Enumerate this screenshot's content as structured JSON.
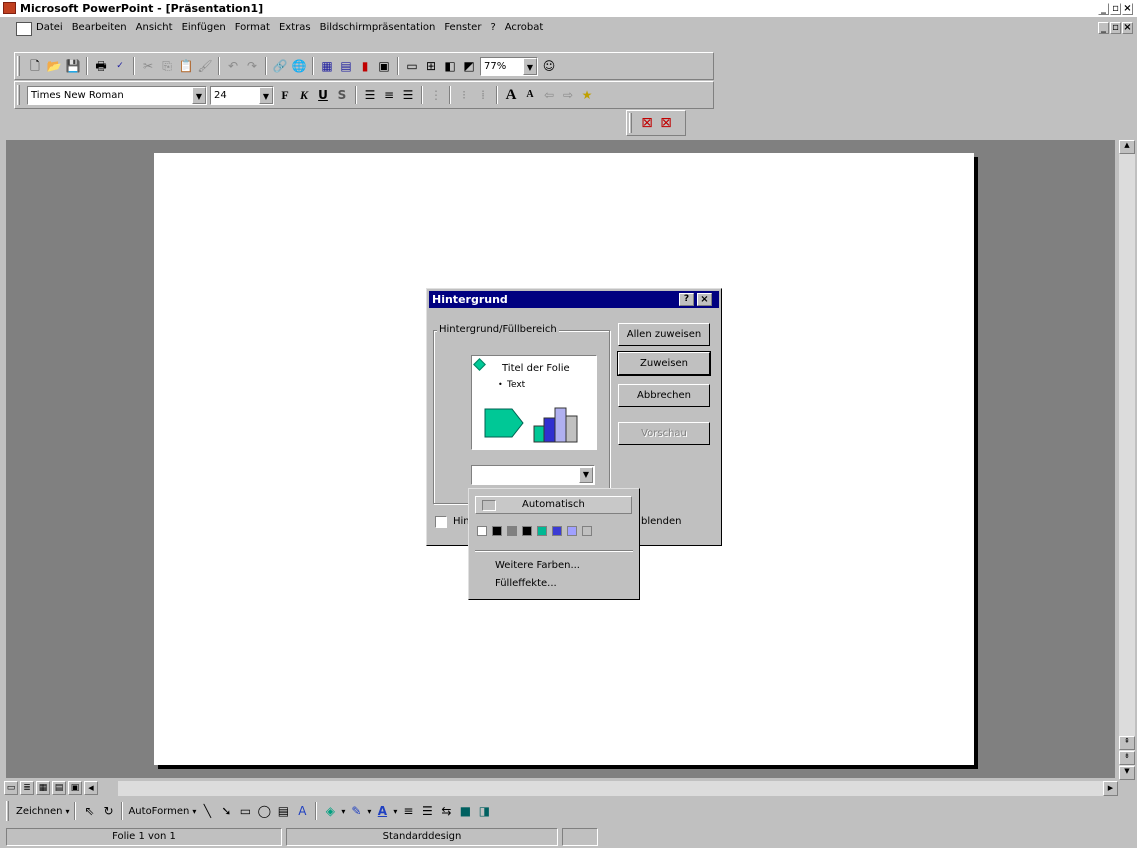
{
  "window": {
    "title": "Microsoft PowerPoint - [Präsentation1]",
    "controls": [
      "_",
      "▫",
      "×"
    ]
  },
  "menu": {
    "items": [
      "Datei",
      "Bearbeiten",
      "Ansicht",
      "Einfügen",
      "Format",
      "Extras",
      "Bildschirmpräsentation",
      "Fenster",
      "?",
      "Acrobat"
    ]
  },
  "standard_toolbar": {
    "zoom": "77%"
  },
  "format_toolbar": {
    "font": "Times New Roman",
    "size": "24",
    "bold_label": "F",
    "italic_label": "K",
    "underline_label": "U",
    "shadow_label": "S"
  },
  "dialog": {
    "title": "Hintergrund",
    "group_label": "Hintergrund/Füllbereich",
    "preview": {
      "slide_title": "Titel der Folie",
      "bullet_text": "Text"
    },
    "checkbox_label_visible": "Hin",
    "checkbox_label_tail": "blenden",
    "buttons": {
      "apply_all": "Allen zuweisen",
      "apply": "Zuweisen",
      "cancel": "Abbrechen",
      "preview": "Vorschau"
    },
    "help_btn": "?",
    "close_btn": "×"
  },
  "color_popup": {
    "automatic_label": "Automatisch",
    "swatches": [
      "#ffffff",
      "#000000",
      "#808080",
      "#000000",
      "#00b894",
      "#3b3bd4",
      "#a0a0ff",
      "#c0c0c0"
    ],
    "more_colors": "Weitere Farben...",
    "fill_effects": "Fülleffekte..."
  },
  "drawing_toolbar": {
    "draw_label": "Zeichnen",
    "autoshapes_label": "AutoFormen"
  },
  "statusbar": {
    "slide_info": "Folie 1 von 1",
    "design": "Standarddesign"
  },
  "colors": {
    "title_bar": "#000080",
    "workspace": "#808080",
    "preview_shape": "#00c896",
    "bar_blue": "#3030d0",
    "bar_light": "#b0b0f0"
  }
}
